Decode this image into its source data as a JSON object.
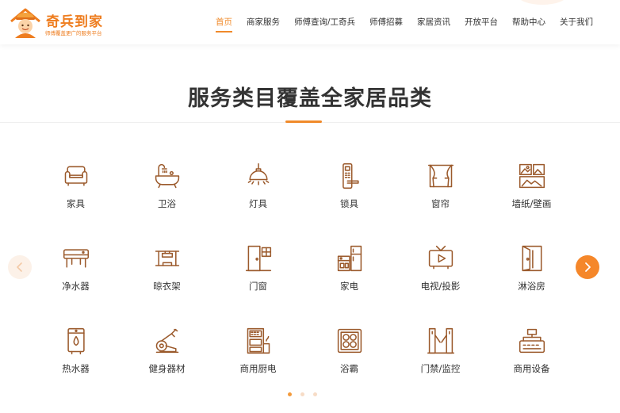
{
  "colors": {
    "accent": "#f08a2a",
    "icon": "#9b5a2c",
    "arrow": "#f5872a"
  },
  "header": {
    "logo": {
      "title": "奇兵到家",
      "tagline": "师傅覆盖更广的服务平台",
      "icon": "worker-mascot-icon"
    },
    "nav": [
      {
        "label": "首页",
        "active": true
      },
      {
        "label": "商家服务",
        "active": false
      },
      {
        "label": "师傅查询/工奇兵",
        "active": false
      },
      {
        "label": "师傅招募",
        "active": false
      },
      {
        "label": "家居资讯",
        "active": false
      },
      {
        "label": "开放平台",
        "active": false
      },
      {
        "label": "帮助中心",
        "active": false
      },
      {
        "label": "关于我们",
        "active": false
      }
    ]
  },
  "section": {
    "title": "服务类目覆盖全家居品类"
  },
  "categories": [
    {
      "label": "家具",
      "icon": "sofa-icon"
    },
    {
      "label": "卫浴",
      "icon": "bathtub-icon"
    },
    {
      "label": "灯具",
      "icon": "lamp-icon"
    },
    {
      "label": "锁具",
      "icon": "door-lock-icon"
    },
    {
      "label": "窗帘",
      "icon": "curtain-icon"
    },
    {
      "label": "墙纸/壁画",
      "icon": "wallpaper-icon"
    },
    {
      "label": "净水器",
      "icon": "water-purifier-icon"
    },
    {
      "label": "晾衣架",
      "icon": "drying-rack-icon"
    },
    {
      "label": "门窗",
      "icon": "door-window-icon"
    },
    {
      "label": "家电",
      "icon": "appliance-icon"
    },
    {
      "label": "电视/投影",
      "icon": "tv-icon"
    },
    {
      "label": "淋浴房",
      "icon": "shower-room-icon"
    },
    {
      "label": "热水器",
      "icon": "water-heater-icon"
    },
    {
      "label": "健身器材",
      "icon": "fitness-bike-icon"
    },
    {
      "label": "商用厨电",
      "icon": "commercial-kitchen-icon"
    },
    {
      "label": "浴霸",
      "icon": "bath-heater-icon"
    },
    {
      "label": "门禁/监控",
      "icon": "access-gate-icon"
    },
    {
      "label": "商用设备",
      "icon": "cash-register-icon"
    }
  ],
  "carousel": {
    "prev_icon": "chevron-left-icon",
    "next_icon": "chevron-right-icon",
    "page_count": 3,
    "active_page": 1
  }
}
